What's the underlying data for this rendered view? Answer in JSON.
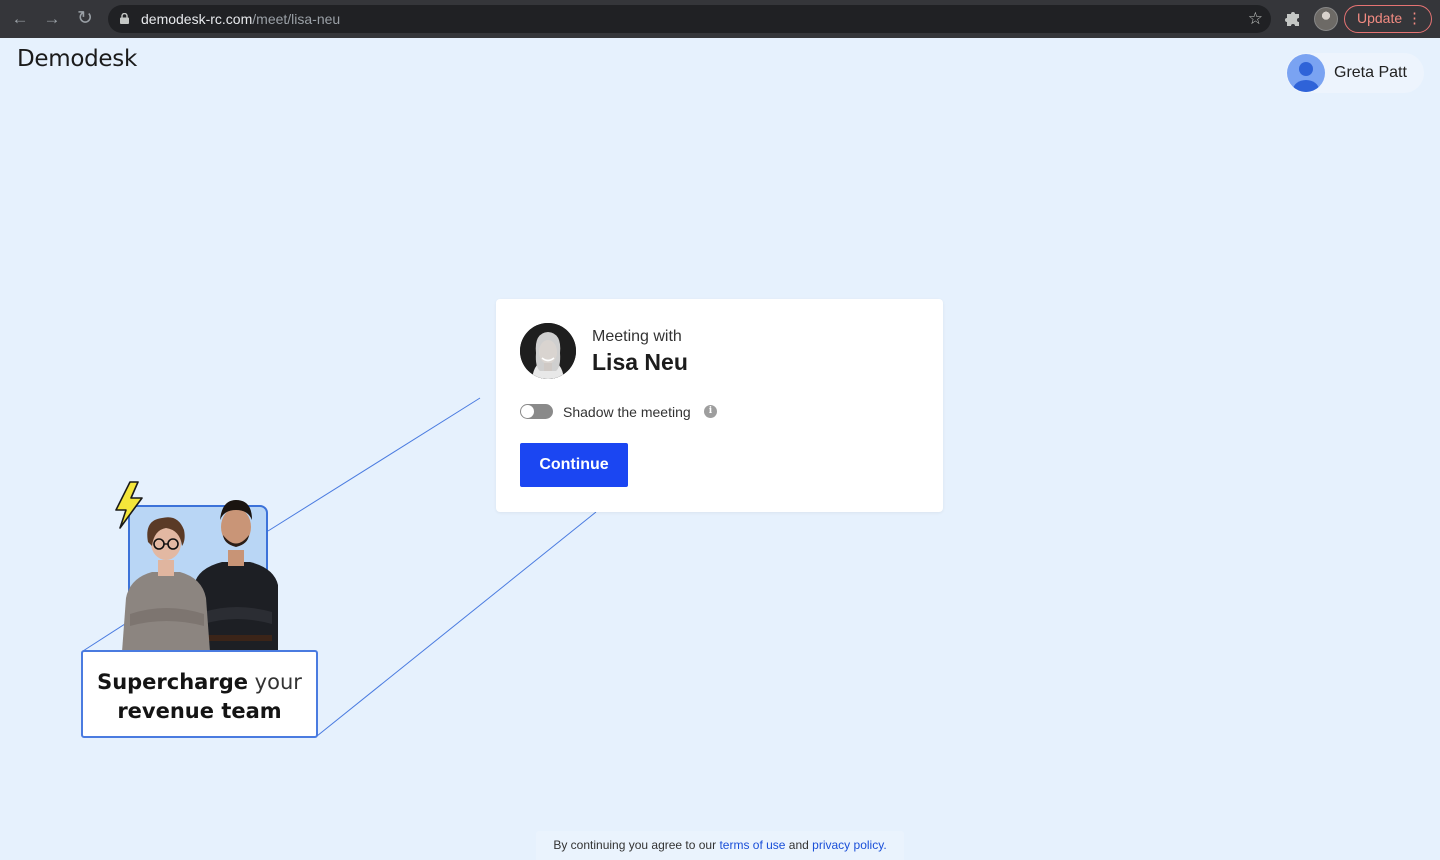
{
  "browser": {
    "url_domain": "demodesk-rc.com",
    "url_path": "/meet/lisa-neu",
    "back_icon": "arrow-left-icon",
    "forward_icon": "arrow-right-icon",
    "reload_icon": "reload-icon",
    "update_label": "Update"
  },
  "header": {
    "logo": "Demodesk",
    "user_name": "Greta Patt"
  },
  "card": {
    "meeting_with": "Meeting with",
    "host_name": "Lisa Neu",
    "shadow_label": "Shadow the meeting",
    "shadow_enabled": false,
    "continue_label": "Continue"
  },
  "promo": {
    "caption_bold_1": "Supercharge",
    "caption_light": " your",
    "caption_bold_2": "revenue team"
  },
  "footer": {
    "prefix": "By continuing you agree to our ",
    "terms_link": "terms of use",
    "middle": " and ",
    "privacy_link": "privacy policy",
    "suffix": "."
  },
  "colors": {
    "background": "#e6f1fd",
    "primary": "#1b46f2",
    "link": "#1a4fd8",
    "accent_line": "#4a7be0"
  }
}
